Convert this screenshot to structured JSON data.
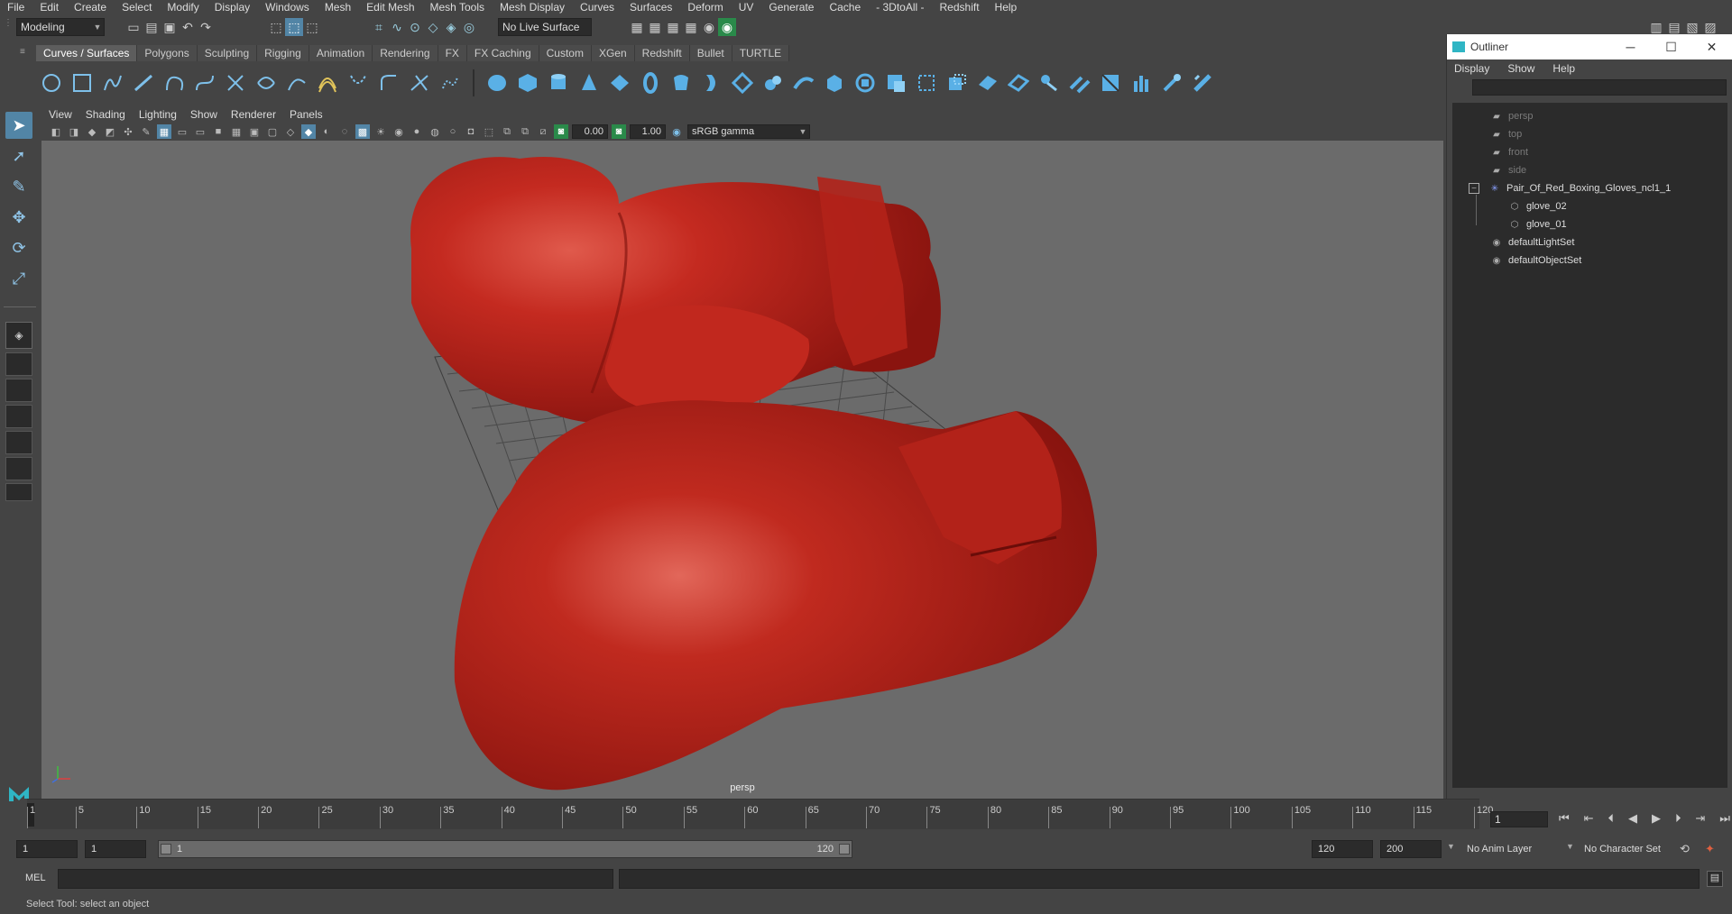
{
  "menubar": {
    "items": [
      "File",
      "Edit",
      "Create",
      "Select",
      "Modify",
      "Display",
      "Windows",
      "Mesh",
      "Edit Mesh",
      "Mesh Tools",
      "Mesh Display",
      "Curves",
      "Surfaces",
      "Deform",
      "UV",
      "Generate",
      "Cache",
      "- 3DtoAll -",
      "Redshift",
      "Help"
    ]
  },
  "statusline": {
    "workspace": "Modeling",
    "live_surface": "No Live Surface"
  },
  "shelf": {
    "tabs": [
      "Curves / Surfaces",
      "Polygons",
      "Sculpting",
      "Rigging",
      "Animation",
      "Rendering",
      "FX",
      "FX Caching",
      "Custom",
      "XGen",
      "Redshift",
      "Bullet",
      "TURTLE"
    ],
    "active_tab": "Curves / Surfaces"
  },
  "panel": {
    "menu": [
      "View",
      "Shading",
      "Lighting",
      "Show",
      "Renderer",
      "Panels"
    ],
    "exposure": "0.00",
    "gamma": "1.00",
    "color_space": "sRGB gamma",
    "camera_label": "persp"
  },
  "outliner": {
    "title": "Outliner",
    "menu": [
      "Display",
      "Show",
      "Help"
    ],
    "items": [
      {
        "label": "persp",
        "dim": true
      },
      {
        "label": "top",
        "dim": true
      },
      {
        "label": "front",
        "dim": true
      },
      {
        "label": "side",
        "dim": true
      },
      {
        "label": "Pair_Of_Red_Boxing_Gloves_ncl1_1",
        "dim": false
      },
      {
        "label": "glove_02",
        "dim": false
      },
      {
        "label": "glove_01",
        "dim": false
      },
      {
        "label": "defaultLightSet",
        "dim": false
      },
      {
        "label": "defaultObjectSet",
        "dim": false
      }
    ]
  },
  "timeline": {
    "ticks": [
      "1",
      "5",
      "10",
      "15",
      "20",
      "25",
      "30",
      "35",
      "40",
      "45",
      "50",
      "55",
      "60",
      "65",
      "70",
      "75",
      "80",
      "85",
      "90",
      "95",
      "100",
      "105",
      "110",
      "115",
      "120"
    ],
    "current_frame": "1"
  },
  "range": {
    "start": "1",
    "start2": "1",
    "inner_start": "1",
    "inner_end": "120",
    "end": "120",
    "end2": "200",
    "anim_layer": "No Anim Layer",
    "character_set": "No Character Set"
  },
  "mel": {
    "label": "MEL"
  },
  "status": {
    "help_line": "Select Tool: select an object"
  },
  "colors": {
    "accent": "#5285a6",
    "glove_red": "#b5201b",
    "viewport_bg": "#6b6b6b"
  }
}
